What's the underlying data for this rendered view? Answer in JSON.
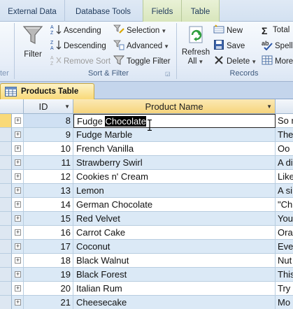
{
  "ribbon_tabs": [
    "External Data",
    "Database Tools",
    "Fields",
    "Table"
  ],
  "sort_filter": {
    "filter_label": "Filter",
    "ascending": "Ascending",
    "descending": "Descending",
    "remove_sort": "Remove Sort",
    "selection": "Selection",
    "advanced": "Advanced",
    "toggle_filter": "Toggle Filter",
    "group_label": "Sort & Filter"
  },
  "records": {
    "refresh_line1": "Refresh",
    "refresh_line2": "All",
    "new": "New",
    "save": "Save",
    "delete": "Delete",
    "totals": "Total",
    "spelling": "Spell",
    "more": "More",
    "group_label": "Records"
  },
  "edge_label": "ter",
  "document_tab": "Products Table",
  "columns": {
    "id": "ID",
    "name": "Product Name"
  },
  "current_row": {
    "id": "8",
    "name_prefix": "Fudge ",
    "name_selected": "Chocolate",
    "desc": "So r"
  },
  "rows": [
    {
      "id": "9",
      "name": "Fudge Marble",
      "desc": "The"
    },
    {
      "id": "10",
      "name": "French Vanilla",
      "desc": "Oo"
    },
    {
      "id": "11",
      "name": "Strawberry Swirl",
      "desc": "A di"
    },
    {
      "id": "12",
      "name": "Cookies n' Cream",
      "desc": "Like"
    },
    {
      "id": "13",
      "name": "Lemon",
      "desc": "A si"
    },
    {
      "id": "14",
      "name": "German Chocolate",
      "desc": "\"Ch"
    },
    {
      "id": "15",
      "name": "Red Velvet",
      "desc": "You"
    },
    {
      "id": "16",
      "name": "Carrot Cake",
      "desc": "Ora"
    },
    {
      "id": "17",
      "name": "Coconut",
      "desc": "Eve"
    },
    {
      "id": "18",
      "name": "Black Walnut",
      "desc": "Nut"
    },
    {
      "id": "19",
      "name": "Black Forest",
      "desc": "This"
    },
    {
      "id": "20",
      "name": "Italian Rum",
      "desc": "Try"
    },
    {
      "id": "21",
      "name": "Cheesecake",
      "desc": "Mo"
    }
  ]
}
